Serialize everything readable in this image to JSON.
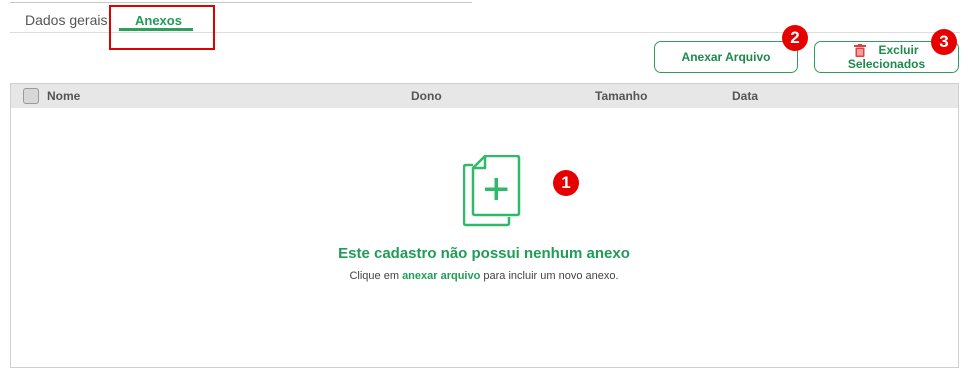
{
  "tabs": [
    {
      "label": "Dados gerais",
      "active": false
    },
    {
      "label": "Anexos",
      "active": true
    }
  ],
  "toolbar": {
    "attach_label": "Anexar Arquivo",
    "delete_line1": "Excluir",
    "delete_line2": "Selecionados"
  },
  "table": {
    "columns": [
      "Nome",
      "Dono",
      "Tamanho",
      "Data"
    ],
    "rows": []
  },
  "empty_state": {
    "title": "Este cadastro não possui nenhum anexo",
    "sub_prefix": "Clique em",
    "sub_link": "anexar arquivo",
    "sub_suffix": "para incluir um novo anexo.",
    "icon": "file-add-icon"
  },
  "annotations": [
    "1",
    "2",
    "3"
  ],
  "colors": {
    "accent": "#1f9d57",
    "annotation": "#e60000",
    "header_bg": "#e7e7e7"
  }
}
